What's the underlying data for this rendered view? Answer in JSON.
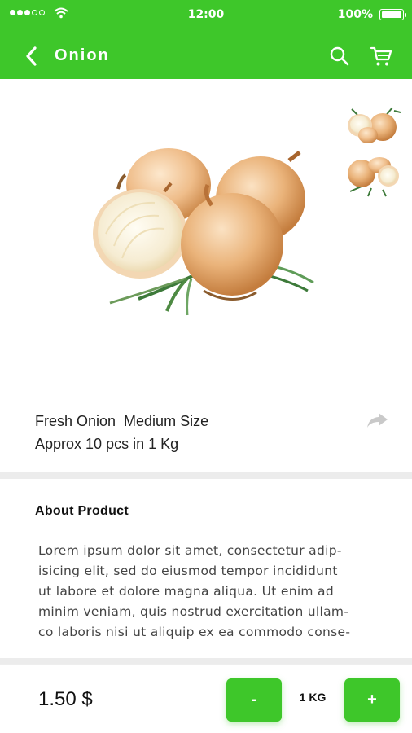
{
  "colors": {
    "accent": "#3ec72a",
    "background": "#ffffff",
    "divider": "#ececec"
  },
  "status_bar": {
    "time": "12:00",
    "battery": "100%"
  },
  "app_bar": {
    "title": "Onion",
    "back_icon": "chevron-left-icon",
    "search_icon": "search-icon",
    "cart_icon": "cart-icon"
  },
  "product": {
    "title_line1": "Fresh Onion  Medium Size",
    "title_line2": "Approx 10 pcs in 1 Kg",
    "share_icon": "share-icon",
    "thumbnail_count": 2
  },
  "about": {
    "heading": "About Product",
    "lines": [
      "Lorem ipsum dolor sit amet, consectetur adip-",
      "isicing elit, sed do eiusmod tempor incididunt",
      "ut labore et dolore magna aliqua. Ut enim ad",
      "minim veniam, quis nostrud exercitation ullam-",
      "co laboris nisi ut aliquip ex ea commodo conse-"
    ]
  },
  "cart_bar": {
    "price": "1.50 $",
    "minus_label": "-",
    "quantity": "1 KG",
    "plus_label": "+"
  }
}
